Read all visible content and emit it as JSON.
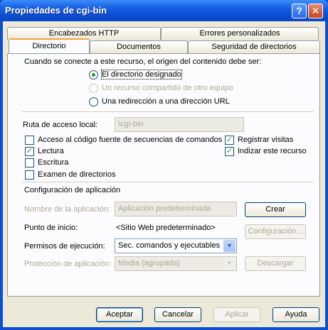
{
  "window": {
    "title": "Propiedades de cgi-bin",
    "help_glyph": "?",
    "close_glyph": "✕"
  },
  "tabs": {
    "row1": [
      "Encabezados HTTP",
      "Errores personalizados"
    ],
    "row2": [
      "Directorio",
      "Documentos",
      "Seguridad de directorios"
    ]
  },
  "content_source": {
    "prompt": "Cuando se conecte a este recurso, el origen del contenido debe ser:",
    "options": [
      {
        "label": "El directorio designado",
        "selected": true,
        "enabled": true
      },
      {
        "label": "Un recurso compartido de otro equipo",
        "selected": false,
        "enabled": false
      },
      {
        "label": "Una redirección a una dirección URL",
        "selected": false,
        "enabled": true
      }
    ]
  },
  "local_path": {
    "label": "Ruta de acceso local:",
    "value": "\\cgi-bin"
  },
  "permissions": [
    {
      "label": "Acceso al código fuente de secuencias de comandos",
      "checked": false
    },
    {
      "label": "Lectura",
      "checked": true
    },
    {
      "label": "Escritura",
      "checked": false
    },
    {
      "label": "Examen de directorios",
      "checked": false
    },
    {
      "label": "Registrar visitas",
      "checked": true
    },
    {
      "label": "Indizar este recurso",
      "checked": true
    }
  ],
  "app_config": {
    "heading": "Configuración de aplicación",
    "app_name_label": "Nombre de la aplicación:",
    "app_name_value": "Aplicación predeterminada",
    "create_button": "Crear",
    "start_point_label": "Punto de inicio:",
    "start_point_value": "<Sitio Web predeterminado>",
    "config_button": "Configuración...",
    "exec_perms_label": "Permisos de ejecución:",
    "exec_perms_value": "Sec. comandos y ejecutables",
    "app_protection_label": "Protección de aplicación:",
    "app_protection_value": "Media (agrupada)",
    "unload_button": "Descargar"
  },
  "footer": {
    "ok": "Aceptar",
    "cancel": "Cancelar",
    "apply": "Aplicar",
    "help": "Ayuda"
  }
}
